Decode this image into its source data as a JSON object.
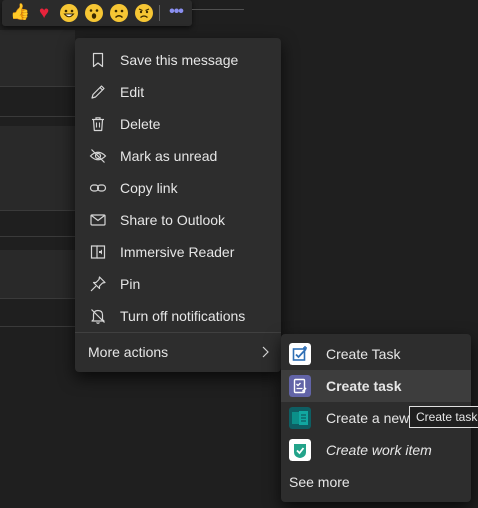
{
  "reactions": {
    "items": [
      {
        "name": "like",
        "glyph": "👍"
      },
      {
        "name": "heart",
        "glyph": "♥"
      },
      {
        "name": "laugh",
        "glyph": "😁"
      },
      {
        "name": "surprised",
        "glyph": "😮"
      },
      {
        "name": "sad",
        "glyph": "☹"
      },
      {
        "name": "angry",
        "glyph": "☹"
      }
    ],
    "more_glyph": "•••"
  },
  "menu": {
    "items": [
      {
        "label": "Save this message",
        "icon": "bookmark-icon"
      },
      {
        "label": "Edit",
        "icon": "pencil-icon"
      },
      {
        "label": "Delete",
        "icon": "trash-icon"
      },
      {
        "label": "Mark as unread",
        "icon": "eye-slash-icon"
      },
      {
        "label": "Copy link",
        "icon": "link-icon"
      },
      {
        "label": "Share to Outlook",
        "icon": "mail-icon"
      },
      {
        "label": "Immersive Reader",
        "icon": "immersive-reader-icon"
      },
      {
        "label": "Pin",
        "icon": "pin-icon"
      },
      {
        "label": "Turn off notifications",
        "icon": "bell-off-icon"
      }
    ],
    "more_actions_label": "More actions"
  },
  "submenu": {
    "items": [
      {
        "label": "Create Task",
        "icon": "planner-task-icon"
      },
      {
        "label": "Create task",
        "icon": "tasks-app-icon"
      },
      {
        "label": "Create a new",
        "icon": "lists-app-icon"
      },
      {
        "label": "Create work item",
        "icon": "work-item-app-icon"
      }
    ],
    "see_more_label": "See more"
  },
  "tooltip": {
    "text": "Create task"
  },
  "colors": {
    "background": "#1f1f1f",
    "menu_bg": "#2d2d2d",
    "hover_bg": "#3d3d3d",
    "accent": "#6264a7",
    "text": "#e6e6e6"
  }
}
